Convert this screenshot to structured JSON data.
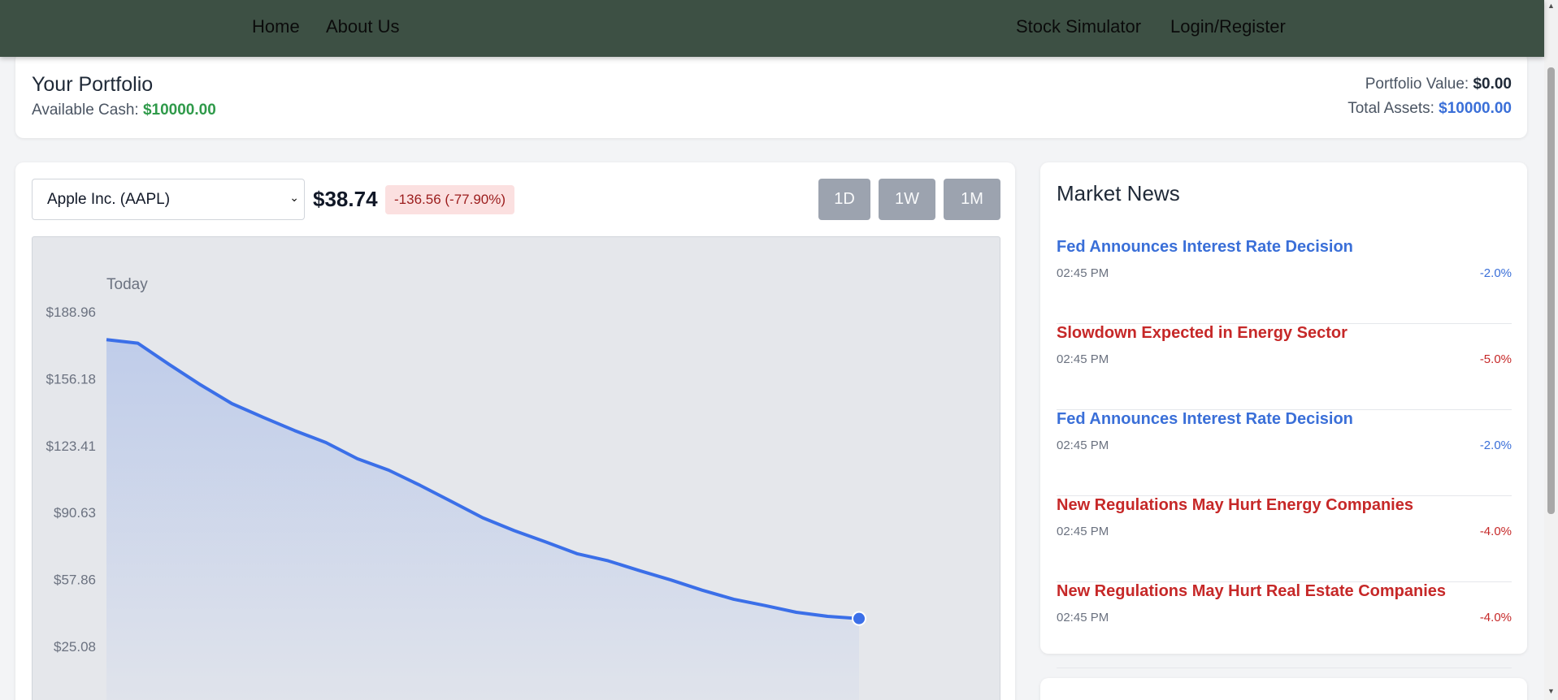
{
  "nav": {
    "home": "Home",
    "about": "About Us",
    "simulator": "Stock Simulator",
    "login": "Login/Register"
  },
  "portfolio": {
    "title": "Your Portfolio",
    "cash_label": "Available Cash:",
    "cash_value": "$10000.00",
    "value_label": "Portfolio Value:",
    "value_value": "$0.00",
    "assets_label": "Total Assets:",
    "assets_value": "$10000.00"
  },
  "stock": {
    "selected": "Apple Inc. (AAPL)",
    "price": "$38.74",
    "change": "-136.56 (-77.90%)",
    "timeframes": [
      "1D",
      "1W",
      "1M"
    ]
  },
  "chart_data": {
    "type": "area",
    "title": "Today",
    "ylabel": "",
    "xlabel": "",
    "yticks": [
      "$188.96",
      "$156.18",
      "$123.41",
      "$90.63",
      "$57.86",
      "$25.08"
    ],
    "ylim": [
      25.08,
      188.96
    ],
    "color": "#3b6fe8",
    "series": [
      {
        "values": [
          175.3,
          173.6,
          163.2,
          153.2,
          144.0,
          137.3,
          130.8,
          124.9,
          117.0,
          111.4,
          104.0,
          96.1,
          88.1,
          81.8,
          76.3,
          70.5,
          67.0,
          62.2,
          57.6,
          52.6,
          48.2,
          45.1,
          41.8,
          39.8,
          38.74
        ]
      }
    ]
  },
  "news": {
    "title": "Market News",
    "items": [
      {
        "headline": "Fed Announces Interest Rate Decision",
        "time": "02:45 PM",
        "change": "-2.0%",
        "tone": "blue"
      },
      {
        "headline": "Slowdown Expected in Energy Sector",
        "time": "02:45 PM",
        "change": "-5.0%",
        "tone": "red"
      },
      {
        "headline": "Fed Announces Interest Rate Decision",
        "time": "02:45 PM",
        "change": "-2.0%",
        "tone": "blue"
      },
      {
        "headline": "New Regulations May Hurt Energy Companies",
        "time": "02:45 PM",
        "change": "-4.0%",
        "tone": "red"
      },
      {
        "headline": "New Regulations May Hurt Real Estate Companies",
        "time": "02:45 PM",
        "change": "-4.0%",
        "tone": "red"
      }
    ]
  }
}
